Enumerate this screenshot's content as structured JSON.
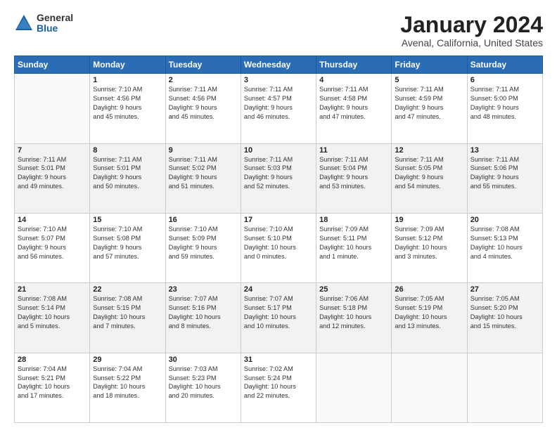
{
  "logo": {
    "general": "General",
    "blue": "Blue"
  },
  "title": {
    "month_year": "January 2024",
    "location": "Avenal, California, United States"
  },
  "days_of_week": [
    "Sunday",
    "Monday",
    "Tuesday",
    "Wednesday",
    "Thursday",
    "Friday",
    "Saturday"
  ],
  "weeks": [
    [
      {
        "num": "",
        "info": ""
      },
      {
        "num": "1",
        "info": "Sunrise: 7:10 AM\nSunset: 4:56 PM\nDaylight: 9 hours\nand 45 minutes."
      },
      {
        "num": "2",
        "info": "Sunrise: 7:11 AM\nSunset: 4:56 PM\nDaylight: 9 hours\nand 45 minutes."
      },
      {
        "num": "3",
        "info": "Sunrise: 7:11 AM\nSunset: 4:57 PM\nDaylight: 9 hours\nand 46 minutes."
      },
      {
        "num": "4",
        "info": "Sunrise: 7:11 AM\nSunset: 4:58 PM\nDaylight: 9 hours\nand 47 minutes."
      },
      {
        "num": "5",
        "info": "Sunrise: 7:11 AM\nSunset: 4:59 PM\nDaylight: 9 hours\nand 47 minutes."
      },
      {
        "num": "6",
        "info": "Sunrise: 7:11 AM\nSunset: 5:00 PM\nDaylight: 9 hours\nand 48 minutes."
      }
    ],
    [
      {
        "num": "7",
        "info": "Sunrise: 7:11 AM\nSunset: 5:01 PM\nDaylight: 9 hours\nand 49 minutes."
      },
      {
        "num": "8",
        "info": "Sunrise: 7:11 AM\nSunset: 5:01 PM\nDaylight: 9 hours\nand 50 minutes."
      },
      {
        "num": "9",
        "info": "Sunrise: 7:11 AM\nSunset: 5:02 PM\nDaylight: 9 hours\nand 51 minutes."
      },
      {
        "num": "10",
        "info": "Sunrise: 7:11 AM\nSunset: 5:03 PM\nDaylight: 9 hours\nand 52 minutes."
      },
      {
        "num": "11",
        "info": "Sunrise: 7:11 AM\nSunset: 5:04 PM\nDaylight: 9 hours\nand 53 minutes."
      },
      {
        "num": "12",
        "info": "Sunrise: 7:11 AM\nSunset: 5:05 PM\nDaylight: 9 hours\nand 54 minutes."
      },
      {
        "num": "13",
        "info": "Sunrise: 7:11 AM\nSunset: 5:06 PM\nDaylight: 9 hours\nand 55 minutes."
      }
    ],
    [
      {
        "num": "14",
        "info": "Sunrise: 7:10 AM\nSunset: 5:07 PM\nDaylight: 9 hours\nand 56 minutes."
      },
      {
        "num": "15",
        "info": "Sunrise: 7:10 AM\nSunset: 5:08 PM\nDaylight: 9 hours\nand 57 minutes."
      },
      {
        "num": "16",
        "info": "Sunrise: 7:10 AM\nSunset: 5:09 PM\nDaylight: 9 hours\nand 59 minutes."
      },
      {
        "num": "17",
        "info": "Sunrise: 7:10 AM\nSunset: 5:10 PM\nDaylight: 10 hours\nand 0 minutes."
      },
      {
        "num": "18",
        "info": "Sunrise: 7:09 AM\nSunset: 5:11 PM\nDaylight: 10 hours\nand 1 minute."
      },
      {
        "num": "19",
        "info": "Sunrise: 7:09 AM\nSunset: 5:12 PM\nDaylight: 10 hours\nand 3 minutes."
      },
      {
        "num": "20",
        "info": "Sunrise: 7:08 AM\nSunset: 5:13 PM\nDaylight: 10 hours\nand 4 minutes."
      }
    ],
    [
      {
        "num": "21",
        "info": "Sunrise: 7:08 AM\nSunset: 5:14 PM\nDaylight: 10 hours\nand 5 minutes."
      },
      {
        "num": "22",
        "info": "Sunrise: 7:08 AM\nSunset: 5:15 PM\nDaylight: 10 hours\nand 7 minutes."
      },
      {
        "num": "23",
        "info": "Sunrise: 7:07 AM\nSunset: 5:16 PM\nDaylight: 10 hours\nand 8 minutes."
      },
      {
        "num": "24",
        "info": "Sunrise: 7:07 AM\nSunset: 5:17 PM\nDaylight: 10 hours\nand 10 minutes."
      },
      {
        "num": "25",
        "info": "Sunrise: 7:06 AM\nSunset: 5:18 PM\nDaylight: 10 hours\nand 12 minutes."
      },
      {
        "num": "26",
        "info": "Sunrise: 7:05 AM\nSunset: 5:19 PM\nDaylight: 10 hours\nand 13 minutes."
      },
      {
        "num": "27",
        "info": "Sunrise: 7:05 AM\nSunset: 5:20 PM\nDaylight: 10 hours\nand 15 minutes."
      }
    ],
    [
      {
        "num": "28",
        "info": "Sunrise: 7:04 AM\nSunset: 5:21 PM\nDaylight: 10 hours\nand 17 minutes."
      },
      {
        "num": "29",
        "info": "Sunrise: 7:04 AM\nSunset: 5:22 PM\nDaylight: 10 hours\nand 18 minutes."
      },
      {
        "num": "30",
        "info": "Sunrise: 7:03 AM\nSunset: 5:23 PM\nDaylight: 10 hours\nand 20 minutes."
      },
      {
        "num": "31",
        "info": "Sunrise: 7:02 AM\nSunset: 5:24 PM\nDaylight: 10 hours\nand 22 minutes."
      },
      {
        "num": "",
        "info": ""
      },
      {
        "num": "",
        "info": ""
      },
      {
        "num": "",
        "info": ""
      }
    ]
  ]
}
